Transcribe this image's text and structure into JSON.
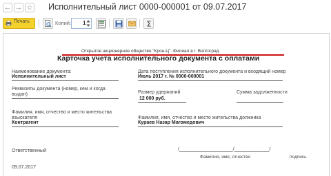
{
  "window": {
    "title": "Исполнительный лист 0000-000001 от 09.07.2017"
  },
  "toolbar": {
    "print_label": "Печать",
    "copies_label": "Копий:",
    "copies_value": "1"
  },
  "document": {
    "organization": "Открытое акционерное общество \"Крон-Ц\". Филиал в г. Волгоград",
    "title": "Карточка учета исполнительного документа с оплатами",
    "doc_name_label": "Наименование документа:",
    "doc_name_value": "Исполнительный лист",
    "receipt_label": "Дата поступления исполнительного документа и входящий номер",
    "receipt_value": "Июль 2017 г. № 0000-000001",
    "requisites_label_1": "Реквизиты документа (номер, кем и когда",
    "requisites_label_2": "выдан)",
    "deduction_label": "Размер удержаний",
    "deduction_value": "12 000  руб.",
    "debt_label": "Сумма задолженности",
    "collector_label_1": "Фамилия, имя, отчество и место жительства",
    "collector_label_2": "взыскателя",
    "collector_value": "Контрагент",
    "debtor_label": "Фамилия, имя, отчество и место жительства должника",
    "debtor_value": "Кураев Назар Магомедович",
    "responsible_label": "Ответственный",
    "sig_line": "/____________________/_____________/",
    "sig_caption_name": "Фамилия, имя, отчество",
    "sig_caption_sign": "подпись",
    "date": "09.07.2017"
  }
}
